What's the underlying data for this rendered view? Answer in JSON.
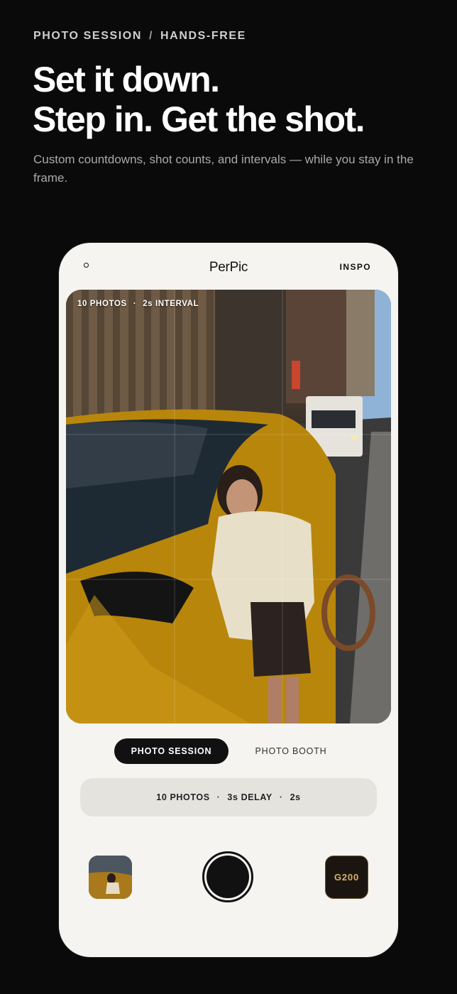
{
  "eyebrow": {
    "left": "PHOTO SESSION",
    "separator": "/",
    "right": "HANDS-FREE"
  },
  "headline": {
    "line1": "Set it down.",
    "line2": "Step in. Get the shot."
  },
  "subheadline": "Custom countdowns, shot counts, and intervals — while you stay in the frame.",
  "app": {
    "title": "PerPic",
    "inspo_label": "INSPO",
    "viewfinder": {
      "photos": "10 PHOTOS",
      "separator": "·",
      "interval": "2s INTERVAL"
    },
    "modes": {
      "active": "PHOTO SESSION",
      "inactive": "PHOTO BOOTH"
    },
    "settings": {
      "photos": "10 PHOTOS",
      "delay": "3s DELAY",
      "interval": "2s",
      "separator": "·"
    },
    "film_label": "G200"
  },
  "colors": {
    "background": "#0a0a0b",
    "phone": "#f5f4f1",
    "film_accent": "#d7b26a"
  },
  "icons": {
    "top_left": "record-dot-icon",
    "shutter": "shutter-button-icon"
  }
}
